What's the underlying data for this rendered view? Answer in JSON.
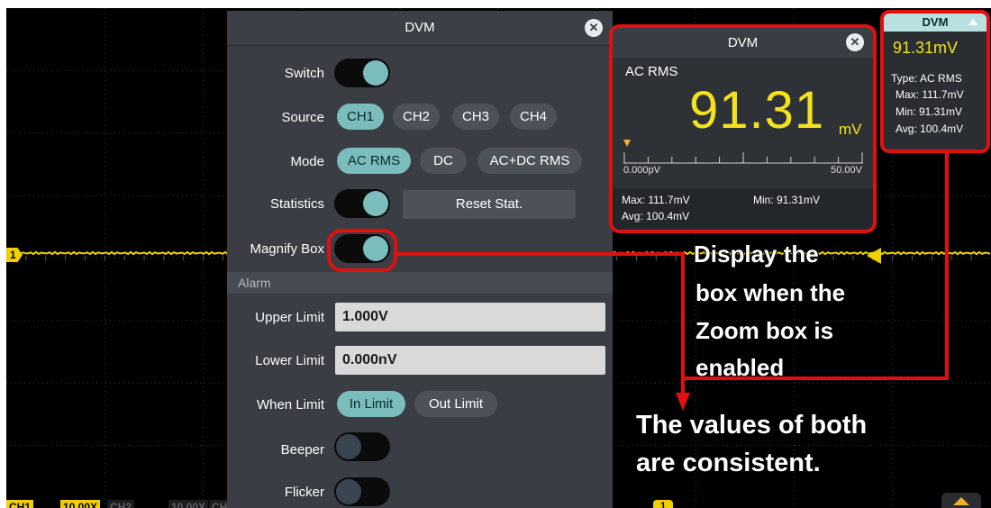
{
  "dvm_panel": {
    "title": "DVM",
    "switch_label": "Switch",
    "source_label": "Source",
    "source_options": [
      "CH1",
      "CH2",
      "CH3",
      "CH4"
    ],
    "source_selected": "CH1",
    "mode_label": "Mode",
    "mode_options": [
      "AC RMS",
      "DC",
      "AC+DC RMS"
    ],
    "mode_selected": "AC RMS",
    "statistics_label": "Statistics",
    "reset_stat_label": "Reset Stat.",
    "magnify_box_label": "Magnify Box",
    "alarm_section": "Alarm",
    "upper_limit_label": "Upper Limit",
    "upper_limit_value": "1.000V",
    "lower_limit_label": "Lower Limit",
    "lower_limit_value": "0.000nV",
    "when_limit_label": "When Limit",
    "when_limit_options": [
      "In Limit",
      "Out Limit"
    ],
    "when_limit_selected": "In Limit",
    "beeper_label": "Beeper",
    "flicker_label": "Flicker",
    "toggles": {
      "switch": true,
      "statistics": true,
      "magnify_box": true,
      "beeper": false,
      "flicker": false
    }
  },
  "dvm_popup": {
    "title": "DVM",
    "mode": "AC RMS",
    "value": "91.31",
    "unit": "mV",
    "scale_min": "0.000pV",
    "scale_max": "50.00V",
    "max_label": "Max: 111.7mV",
    "min_label": "Min: 91.31mV",
    "avg_label": "Avg: 100.4mV"
  },
  "magnify_box": {
    "title": "DVM",
    "value": "91.31mV",
    "type_line": "Type: AC RMS",
    "max_line": "Max: 111.7mV",
    "min_line": "Min: 91.31mV",
    "avg_line": "Avg: 100.4mV"
  },
  "annotations": {
    "display_box_line1": "Display the",
    "display_box_line2": "box when the",
    "display_box_line3": "Zoom box is",
    "display_box_line4": "enabled",
    "consistent_line1": "The values of both",
    "consistent_line2": "are consistent."
  },
  "scope": {
    "channel_marker": "1",
    "trigger_marker": "1",
    "ch1_label": "CH1",
    "ch1_scale": "10.00X",
    "ch2_label": "CH2",
    "ch2_scale": "10.00X",
    "ch3_label_partial": "CH"
  },
  "colors": {
    "accent": "#7bbcbc",
    "highlight": "#e01010",
    "reading": "#f3e21c",
    "trace": "#f0d000"
  }
}
